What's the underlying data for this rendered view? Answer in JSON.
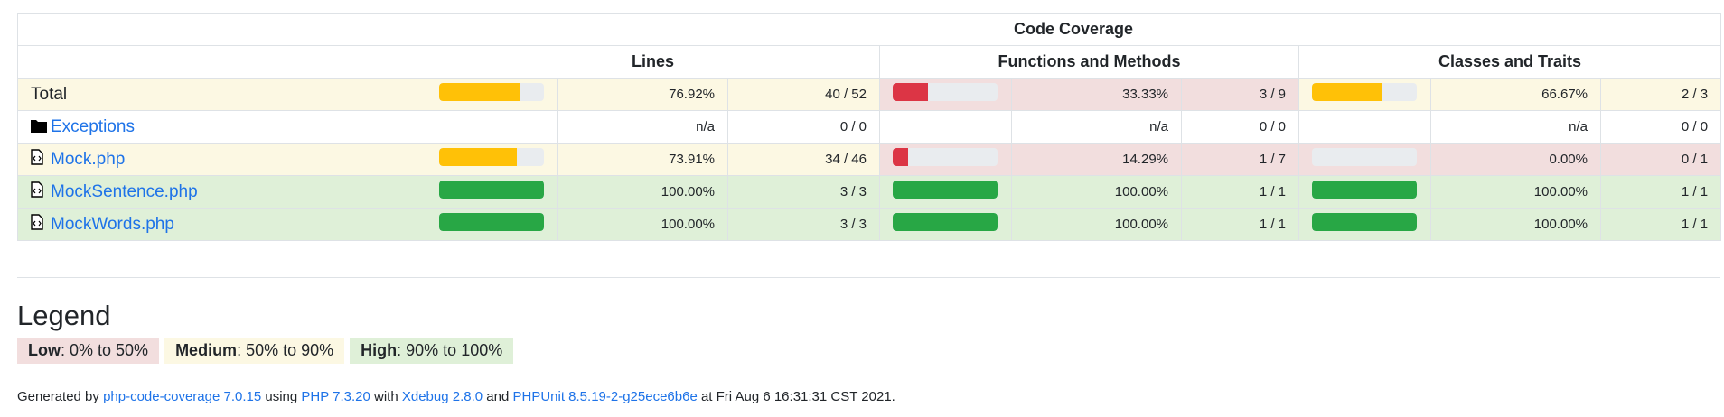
{
  "header": {
    "code_coverage": "Code Coverage",
    "lines": "Lines",
    "functions": "Functions and Methods",
    "classes": "Classes and Traits"
  },
  "rows": [
    {
      "name": "Total",
      "type": "total",
      "link": false,
      "lines": {
        "pct": "76.92%",
        "ratio": "40 / 52",
        "value": 0.7692,
        "level": "med"
      },
      "funcs": {
        "pct": "33.33%",
        "ratio": "3 / 9",
        "value": 0.3333,
        "level": "low"
      },
      "classes": {
        "pct": "66.67%",
        "ratio": "2 / 3",
        "value": 0.6667,
        "level": "med"
      }
    },
    {
      "name": "Exceptions",
      "type": "folder",
      "link": true,
      "lines": {
        "pct": "n/a",
        "ratio": "0 / 0",
        "value": null,
        "level": "none"
      },
      "funcs": {
        "pct": "n/a",
        "ratio": "0 / 0",
        "value": null,
        "level": "none"
      },
      "classes": {
        "pct": "n/a",
        "ratio": "0 / 0",
        "value": null,
        "level": "none"
      }
    },
    {
      "name": "Mock.php",
      "type": "file",
      "link": true,
      "lines": {
        "pct": "73.91%",
        "ratio": "34 / 46",
        "value": 0.7391,
        "level": "med"
      },
      "funcs": {
        "pct": "14.29%",
        "ratio": "1 / 7",
        "value": 0.1429,
        "level": "low"
      },
      "classes": {
        "pct": "0.00%",
        "ratio": "0 / 1",
        "value": 0,
        "level": "low"
      }
    },
    {
      "name": "MockSentence.php",
      "type": "file",
      "link": true,
      "lines": {
        "pct": "100.00%",
        "ratio": "3 / 3",
        "value": 1,
        "level": "high"
      },
      "funcs": {
        "pct": "100.00%",
        "ratio": "1 / 1",
        "value": 1,
        "level": "high"
      },
      "classes": {
        "pct": "100.00%",
        "ratio": "1 / 1",
        "value": 1,
        "level": "high"
      }
    },
    {
      "name": "MockWords.php",
      "type": "file",
      "link": true,
      "lines": {
        "pct": "100.00%",
        "ratio": "3 / 3",
        "value": 1,
        "level": "high"
      },
      "funcs": {
        "pct": "100.00%",
        "ratio": "1 / 1",
        "value": 1,
        "level": "high"
      },
      "classes": {
        "pct": "100.00%",
        "ratio": "1 / 1",
        "value": 1,
        "level": "high"
      }
    }
  ],
  "legend": {
    "title": "Legend",
    "low_label": "Low",
    "low_range": ": 0% to 50%",
    "med_label": "Medium",
    "med_range": ": 50% to 90%",
    "high_label": "High",
    "high_range": ": 90% to 100%"
  },
  "footer": {
    "t1": "Generated by ",
    "l1": "php-code-coverage 7.0.15",
    "t2": " using ",
    "l2": "PHP 7.3.20",
    "t3": " with ",
    "l3": "Xdebug 2.8.0",
    "t4": " and ",
    "l4": "PHPUnit 8.5.19-2-g25ece6b6e",
    "t5": " at Fri Aug 6 16:31:31 CST 2021."
  },
  "colors": {
    "low": "#dc3545",
    "medium": "#ffc107",
    "high": "#28a745",
    "link": "#1e73e8"
  },
  "icons": {
    "folder": "folder-icon",
    "file": "code-file-icon"
  }
}
